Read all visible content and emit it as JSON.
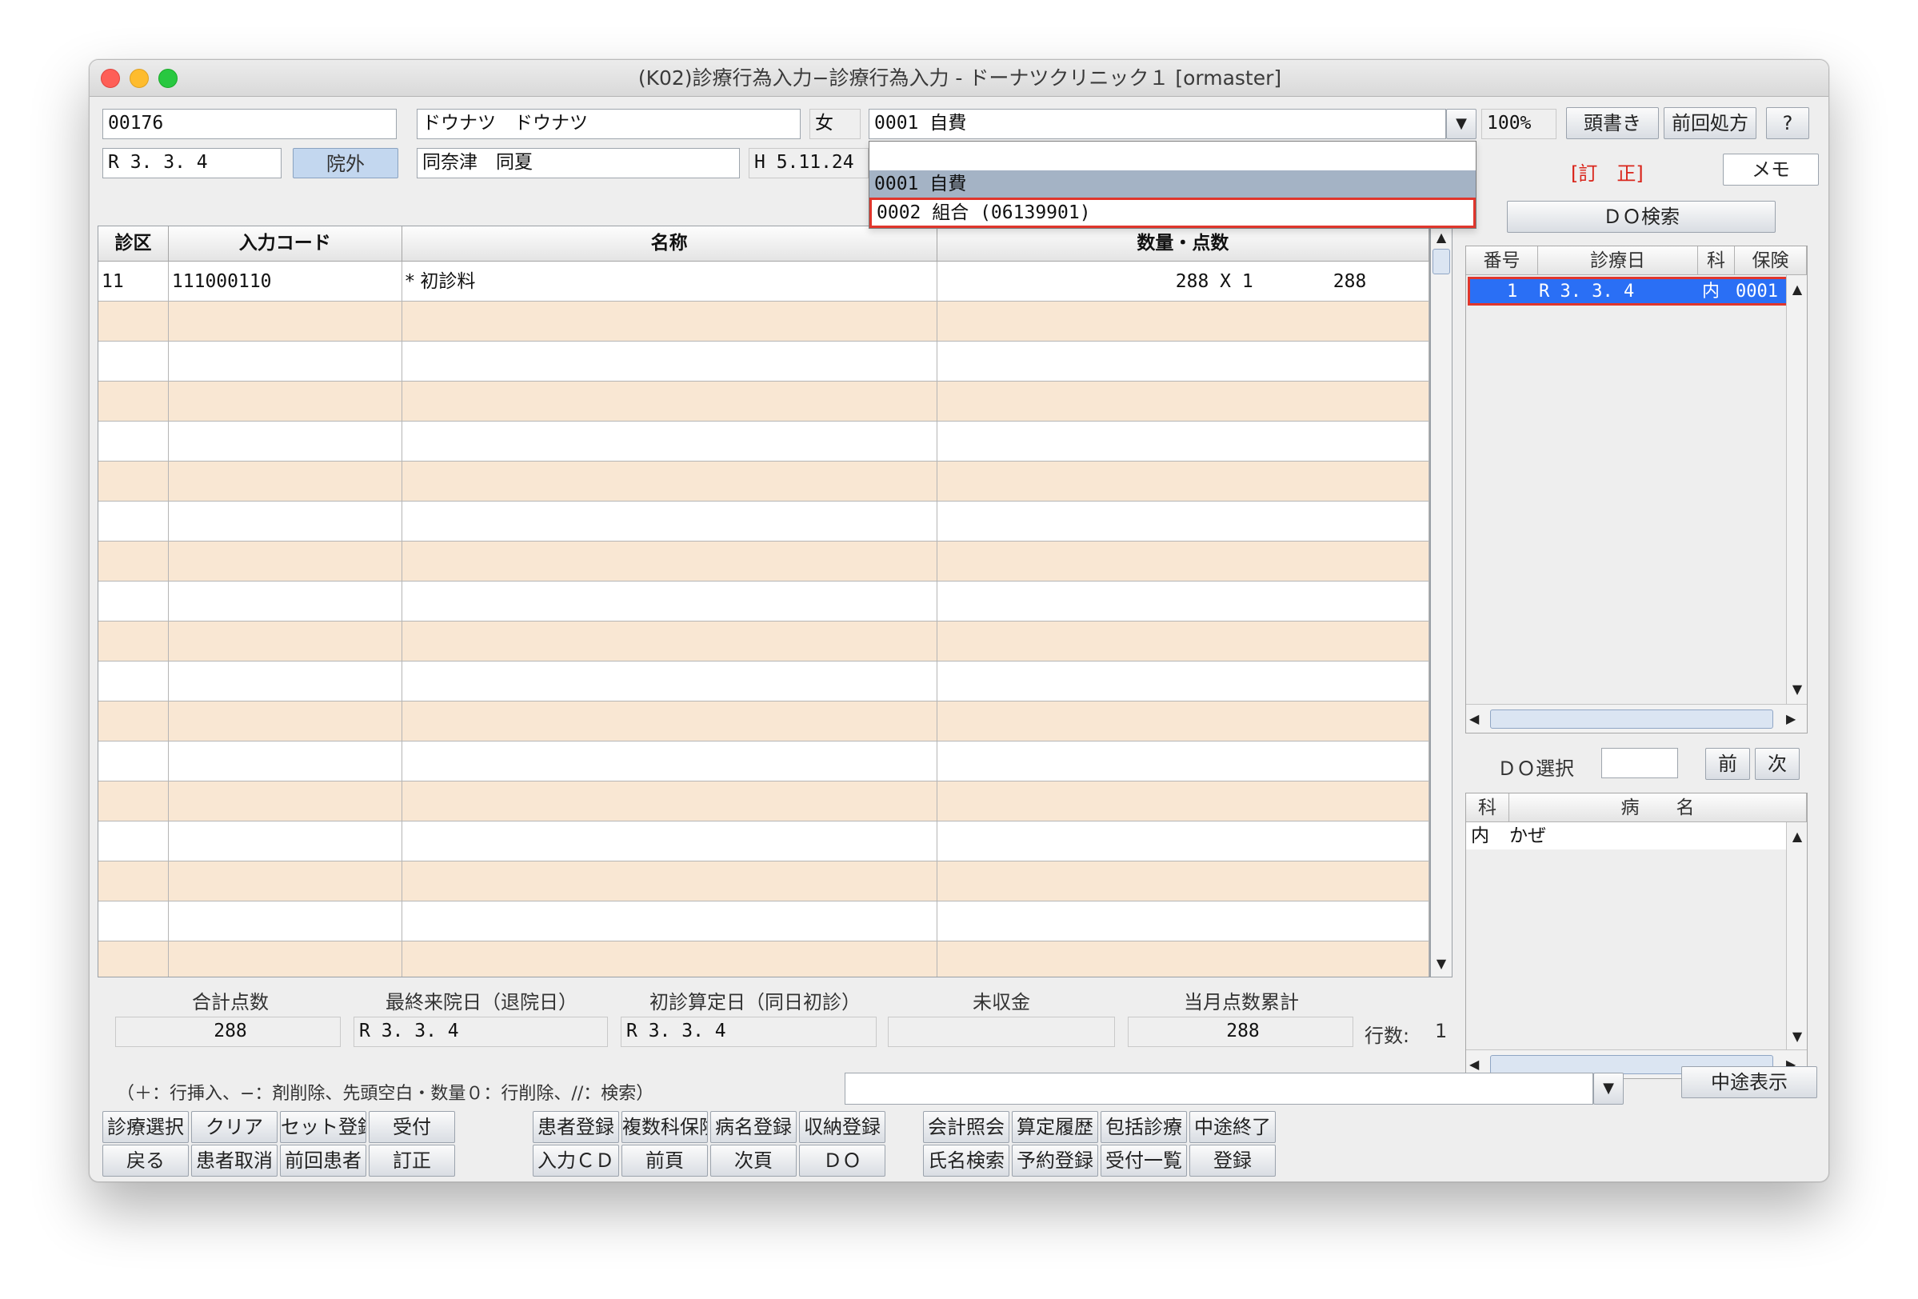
{
  "window": {
    "title": "(K02)診療行為入力−診療行為入力 - ドーナツクリニック１ [ormaster]"
  },
  "patient": {
    "id": "00176",
    "name_kana": "ドウナツ　ドウナツ",
    "sex": "女",
    "date": "R 3. 3. 4",
    "outpatient_label": "院外",
    "name_kanji": "同奈津　同夏",
    "birth": "H 5.11.24"
  },
  "insurance": {
    "selected": "0001 自費",
    "options": [
      "",
      "0001 自費",
      "0002 組合 (06139901)"
    ],
    "zoom": "100%"
  },
  "toolbar_top": {
    "header_btn": "頭書き",
    "prev_rx_btn": "前回処方",
    "help_btn": "?",
    "correction_label": "[訂　正]",
    "memo_btn": "メモ",
    "do_search_btn": "ＤＯ検索"
  },
  "grid": {
    "headers": [
      "診区",
      "入力コード",
      "名称",
      "数量・点数"
    ],
    "rows": [
      {
        "kubun": "11",
        "code": "111000110",
        "name": "* 初診料",
        "qty": "288 X 1",
        "points": "288"
      }
    ]
  },
  "history": {
    "headers": [
      "番号",
      "診療日",
      "科",
      "保険"
    ],
    "rows": [
      {
        "no": "1",
        "date": "R 3. 3. 4",
        "dept": "内",
        "ins": "0001"
      }
    ],
    "do_select_label": "ＤＯ選択",
    "prev_btn": "前",
    "next_btn": "次"
  },
  "disease": {
    "headers": [
      "科",
      "病　　名"
    ],
    "rows": [
      {
        "dept": "内",
        "name": "かぜ"
      }
    ]
  },
  "summary": {
    "labels": [
      "合計点数",
      "最終来院日（退院日）",
      "初診算定日（同日初診）",
      "未収金",
      "当月点数累計"
    ],
    "total_points": "288",
    "last_visit": "R 3. 3. 4",
    "first_visit": "R 3. 3. 4",
    "unpaid": "",
    "month_total": "288",
    "rows_label": "行数:",
    "rows_value": "1"
  },
  "help_text": "（＋：行挿入、−：剤削除、先頭空白・数量０：行削除、//：検索）",
  "midway_btn": "中途表示",
  "buttons": {
    "row1": [
      "診療選択",
      "クリア",
      "セット登録",
      "受付",
      "患者登録",
      "複数科保険",
      "病名登録",
      "収納登録",
      "会計照会",
      "算定履歴",
      "包括診療",
      "中途終了"
    ],
    "row2": [
      "戻る",
      "患者取消",
      "前回患者",
      "訂正",
      "入力ＣＤ",
      "前頁",
      "次頁",
      "ＤＯ",
      "氏名検索",
      "予約登録",
      "受付一覧",
      "登録"
    ]
  },
  "colors": {
    "row_stripe": "#f9e7d3",
    "selection_blue": "#2a6ff5",
    "highlight_red": "#e0362c",
    "dropdown_selected": "#a4b3c5"
  }
}
